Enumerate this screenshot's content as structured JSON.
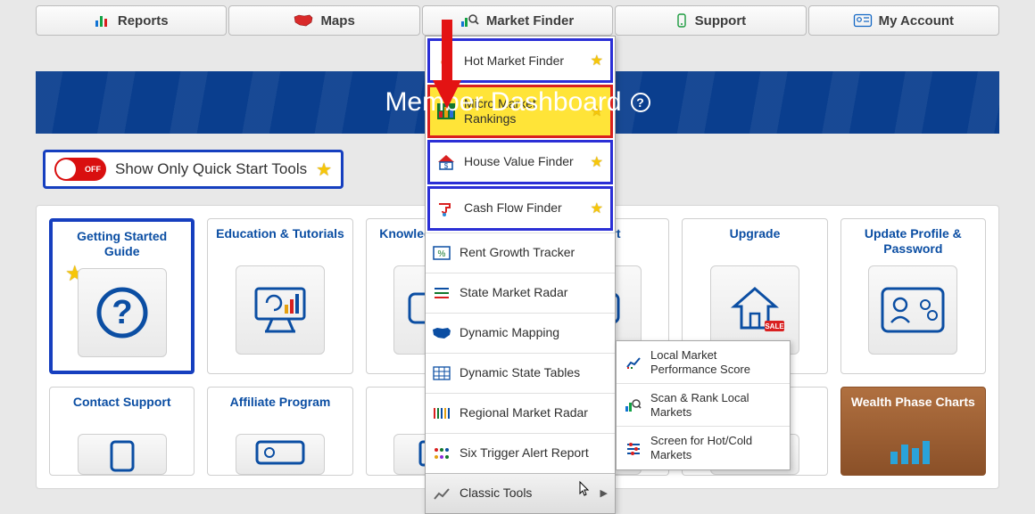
{
  "nav": {
    "reports": "Reports",
    "maps": "Maps",
    "market_finder": "Market Finder",
    "support": "Support",
    "my_account": "My Account"
  },
  "banner": {
    "title": "Member Dashboard"
  },
  "toggle": {
    "switch_state": "OFF",
    "label": "Show Only Quick Start Tools"
  },
  "cards": [
    {
      "title": "Getting Started Guide"
    },
    {
      "title": "Education & Tutorials"
    },
    {
      "title": "Knowledge Support"
    },
    {
      "title": "Support"
    },
    {
      "title": "Upgrade"
    },
    {
      "title": "Update Profile & Password"
    },
    {
      "title": "Contact Support"
    },
    {
      "title": "Affiliate Program"
    },
    {
      "title": ""
    },
    {
      "title": ""
    },
    {
      "title": ""
    },
    {
      "title": "Wealth Phase Charts"
    }
  ],
  "dropdown": [
    {
      "label": "Hot Market Finder",
      "star": true,
      "boxed": true
    },
    {
      "label": "Micro Market Rankings",
      "star": true,
      "highlighted": true
    },
    {
      "label": "House Value Finder",
      "star": true,
      "boxed": true
    },
    {
      "label": "Cash Flow Finder",
      "star": true,
      "boxed": true
    },
    {
      "label": "Rent Growth Tracker"
    },
    {
      "label": "State Market Radar"
    },
    {
      "label": "Dynamic Mapping"
    },
    {
      "label": "Dynamic State Tables"
    },
    {
      "label": "Regional Market Radar"
    },
    {
      "label": "Six Trigger Alert Report"
    },
    {
      "label": "Classic Tools",
      "arrow": true,
      "hover": true
    }
  ],
  "submenu": [
    {
      "label": "Local Market Performance Score"
    },
    {
      "label": "Scan & Rank Local Markets"
    },
    {
      "label": "Screen for Hot/Cold Markets"
    }
  ]
}
